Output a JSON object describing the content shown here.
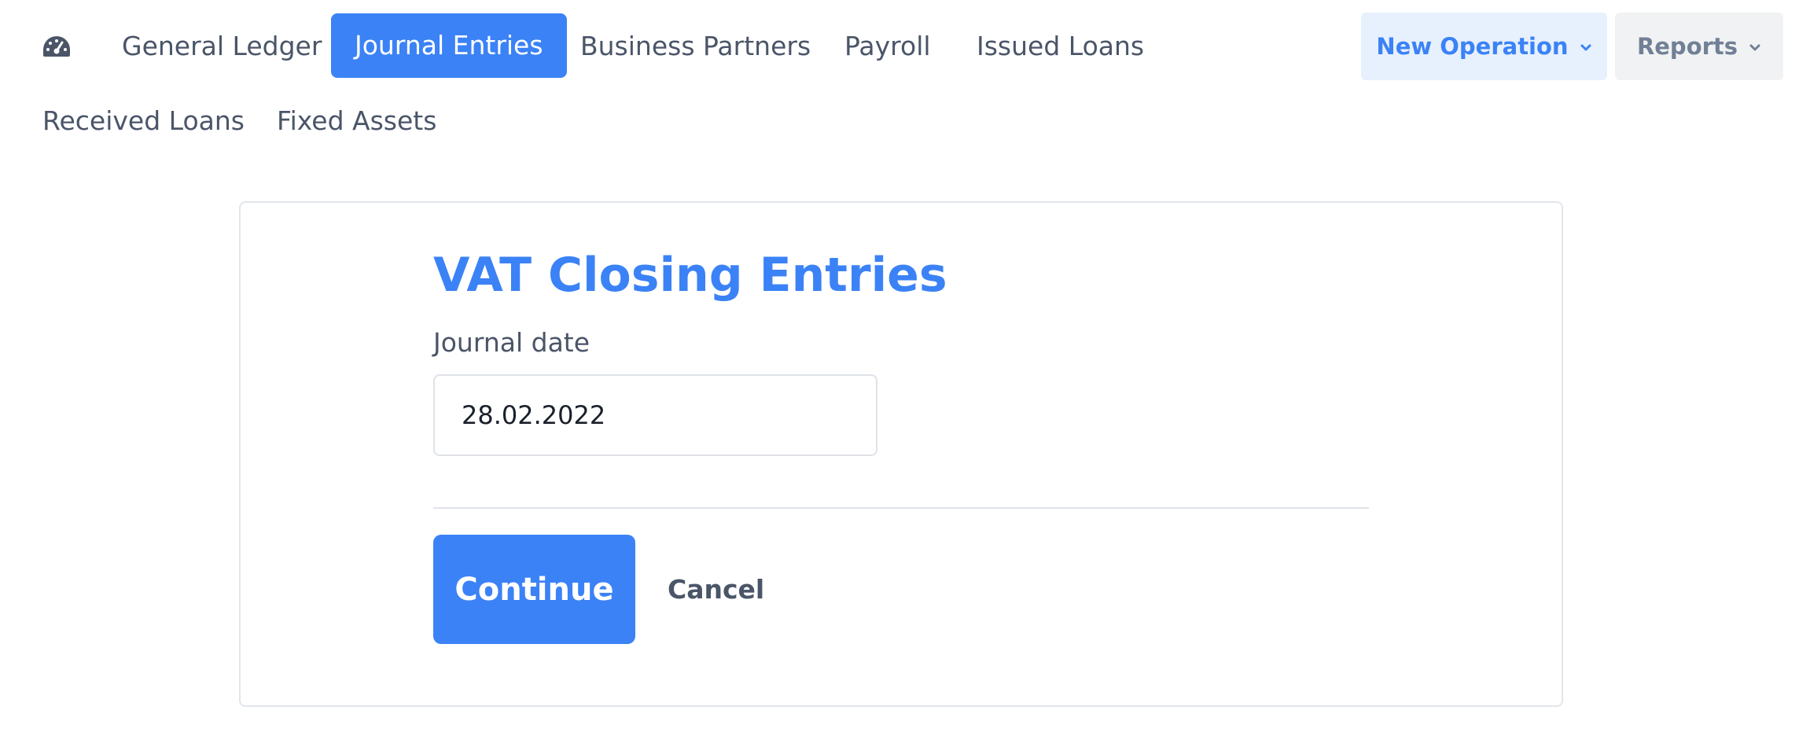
{
  "nav": {
    "icon": "dashboard-gauge-icon",
    "items": [
      {
        "label": "General Ledger"
      },
      {
        "label": "Journal Entries",
        "active": true
      },
      {
        "label": "Business Partners"
      },
      {
        "label": "Payroll"
      },
      {
        "label": "Issued Loans"
      },
      {
        "label": "Received Loans"
      },
      {
        "label": "Fixed Assets"
      }
    ],
    "new_operation_label": "New Operation",
    "reports_label": "Reports"
  },
  "form": {
    "title": "VAT Closing Entries",
    "date_label": "Journal date",
    "date_value": "28.02.2022",
    "continue_label": "Continue",
    "cancel_label": "Cancel"
  },
  "colors": {
    "accent": "#3b82f6",
    "text": "#4a5568",
    "new_operation_bg": "#e7f0fd",
    "reports_bg": "#f1f2f4"
  }
}
